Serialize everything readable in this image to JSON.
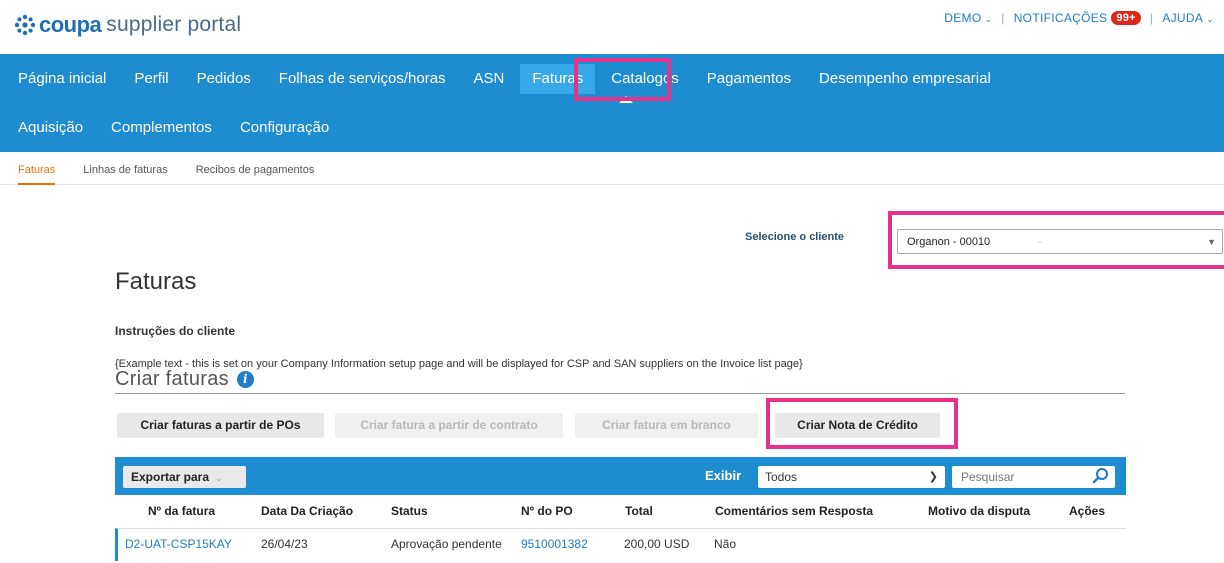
{
  "header": {
    "logo_brand": "coupa",
    "logo_rest": "supplier portal",
    "user_menu": "DEMO",
    "notifications_label": "NOTIFICAÇÕES",
    "notifications_count": "99+",
    "help_menu": "AJUDA"
  },
  "nav": {
    "row1": [
      "Página inicial",
      "Perfil",
      "Pedidos",
      "Folhas de serviços/horas",
      "ASN",
      "Faturas",
      "Catalogos",
      "Pagamentos",
      "Desempenho empresarial"
    ],
    "row2": [
      "Aquisição",
      "Complementos",
      "Configuração"
    ],
    "active": "Faturas"
  },
  "subnav": {
    "items": [
      "Faturas",
      "Linhas de faturas",
      "Recibos de pagamentos"
    ],
    "active": "Faturas"
  },
  "client": {
    "label": "Selecione o cliente",
    "selected": "Organon - 00010",
    "trailing": "-"
  },
  "page": {
    "title": "Faturas",
    "instructions_title": "Instruções do cliente",
    "instructions_text": "{Example text - this is set on your Company Information setup page and will be displayed for CSP and SAN suppliers on the Invoice list page}",
    "create_title": "Criar faturas",
    "info_icon": "i"
  },
  "buttons": {
    "from_pos": "Criar faturas a partir de POs",
    "from_contract": "Criar fatura a partir de contrato",
    "blank": "Criar fatura em branco",
    "credit_note": "Criar Nota de Crédito"
  },
  "table": {
    "export_label": "Exportar para",
    "show_label": "Exibir",
    "show_value": "Todos",
    "search_placeholder": "Pesquisar",
    "columns": [
      "Nº da fatura",
      "Data Da Criação",
      "Status",
      "Nº do PO",
      "Total",
      "Comentários sem Resposta",
      "Motivo da disputa",
      "Ações"
    ],
    "rows": [
      {
        "invoice": "D2-UAT-CSP15KAY",
        "created": "26/04/23",
        "status": "Aprovação pendente",
        "po": "9510001382",
        "total": "200,00 USD",
        "unanswered": "Não",
        "dispute": "",
        "actions": ""
      }
    ]
  },
  "colors": {
    "nav_bg": "#1e8cd1",
    "nav_active": "#36a8e7",
    "highlight": "#e5318a",
    "subnav_active": "#e8730c",
    "link": "#1f7cc7",
    "badge": "#e0251b"
  },
  "icons": {
    "logo": "coupa-logo-icon",
    "info": "info-icon",
    "search": "search-icon",
    "chevron": "chevron-down-icon"
  }
}
